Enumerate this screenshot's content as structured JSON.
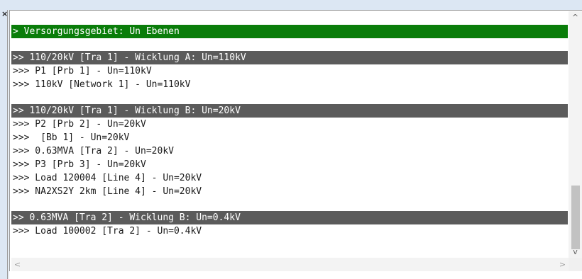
{
  "window": {
    "close_glyph": "×"
  },
  "log": {
    "section1": {
      "title": "> Versorgungsgebiet: Un Ebenen"
    },
    "section2": {
      "title": ">> 110/20kV [Tra 1] - Wicklung A: Un=110kV",
      "items": [
        ">>> P1 [Prb 1] - Un=110kV",
        ">>> 110kV [Network 1] - Un=110kV"
      ]
    },
    "section3": {
      "title": ">> 110/20kV [Tra 1] - Wicklung B: Un=20kV",
      "items": [
        ">>> P2 [Prb 2] - Un=20kV",
        ">>>  [Bb 1] - Un=20kV",
        ">>> 0.63MVA [Tra 2] - Un=20kV",
        ">>> P3 [Prb 3] - Un=20kV",
        ">>> Load 120004 [Line 4] - Un=20kV",
        ">>> NA2XS2Y 2km [Line 4] - Un=20kV"
      ]
    },
    "section4": {
      "title": ">> 0.63MVA [Tra 2] - Wicklung B: Un=0.4kV",
      "items": [
        ">>> Load 100002 [Tra 2] - Un=0.4kV"
      ]
    }
  },
  "scrollbar": {
    "up_glyph": "^",
    "down_glyph": "v",
    "left_glyph": "<",
    "right_glyph": ">"
  },
  "colors": {
    "green_header": "#0a7d0a",
    "gray_header": "#5b5b5b"
  }
}
